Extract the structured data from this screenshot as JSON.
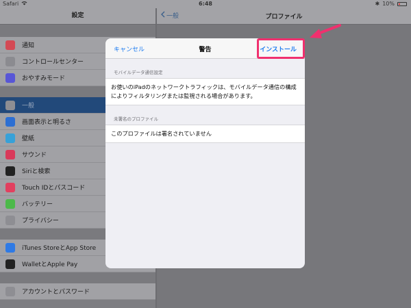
{
  "status_bar": {
    "carrier": "Safari",
    "time": "6:48",
    "battery": "10%"
  },
  "left_pane": {
    "title": "設定",
    "groups": [
      {
        "items": [
          {
            "label": "通知",
            "icon": "bell-icon",
            "color": "#d44a55"
          },
          {
            "label": "コントロールセンター",
            "icon": "controls-icon",
            "color": "#8b8b90"
          },
          {
            "label": "おやすみモード",
            "icon": "moon-icon",
            "color": "#5856d6"
          }
        ]
      },
      {
        "items": [
          {
            "label": "一般",
            "icon": "gear-icon",
            "color": "#8e8e93",
            "selected": true
          },
          {
            "label": "画面表示と明るさ",
            "icon": "text-size-icon",
            "color": "#2d6fd3"
          },
          {
            "label": "壁紙",
            "icon": "flower-icon",
            "color": "#37a1d8"
          },
          {
            "label": "サウンド",
            "icon": "speaker-icon",
            "color": "#d9395a"
          },
          {
            "label": "Siriと検索",
            "icon": "siri-icon",
            "color": "#222222"
          },
          {
            "label": "Touch IDとパスコード",
            "icon": "fingerprint-icon",
            "color": "#e2405f"
          },
          {
            "label": "バッテリー",
            "icon": "battery-icon",
            "color": "#4cb94a"
          },
          {
            "label": "プライバシー",
            "icon": "hand-icon",
            "color": "#8e8e93"
          }
        ]
      },
      {
        "items": [
          {
            "label": "iTunes StoreとApp Store",
            "icon": "app-store-icon",
            "color": "#2f7ae5"
          },
          {
            "label": "WalletとApple Pay",
            "icon": "wallet-icon",
            "color": "#222222"
          }
        ]
      },
      {
        "items": [
          {
            "label": "アカウントとパスワード",
            "icon": "key-icon",
            "color": "#8e8e93"
          }
        ]
      }
    ]
  },
  "right_pane": {
    "back_label": "一般",
    "title": "プロファイル"
  },
  "modal": {
    "cancel_label": "キャンセル",
    "title": "警告",
    "install_label": "インストール",
    "section1_header": "モバイルデータ通信設定",
    "section1_text": "お使いのiPadのネットワークトラフィックは、モバイルデータ通信の構成によりフィルタリングまたは監視される場合があります。",
    "section2_header": "未署名のプロファイル",
    "section2_text": "このプロファイルは署名されていません"
  },
  "colors": {
    "accent": "#1e7cf0",
    "highlight": "#f0306e"
  }
}
